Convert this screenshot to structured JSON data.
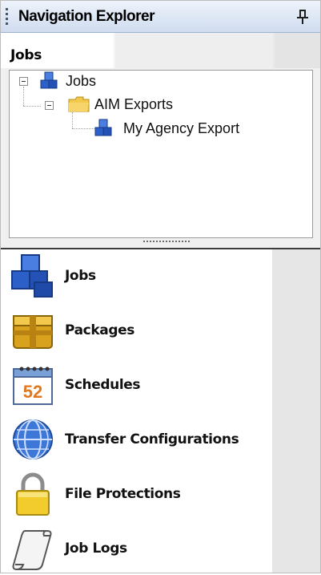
{
  "panel": {
    "title": "Navigation Explorer"
  },
  "section": {
    "title": "Jobs"
  },
  "tree": {
    "root": "Jobs",
    "folder": "AIM Exports",
    "leaf": "My Agency Export"
  },
  "nav": {
    "items": [
      {
        "label": "Jobs",
        "icon": "blocks-icon"
      },
      {
        "label": "Packages",
        "icon": "package-icon"
      },
      {
        "label": "Schedules",
        "icon": "calendar-icon"
      },
      {
        "label": "Transfer Configurations",
        "icon": "globe-icon"
      },
      {
        "label": "File Protections",
        "icon": "lock-icon"
      },
      {
        "label": "Job Logs",
        "icon": "scroll-icon"
      }
    ]
  },
  "calendar_day": "52",
  "colors": {
    "title_bar_top": "#eef3fb",
    "title_bar_bottom": "#cfdcef",
    "accent_blue": "#2d5fc8",
    "folder_yellow": "#f2c94c"
  }
}
